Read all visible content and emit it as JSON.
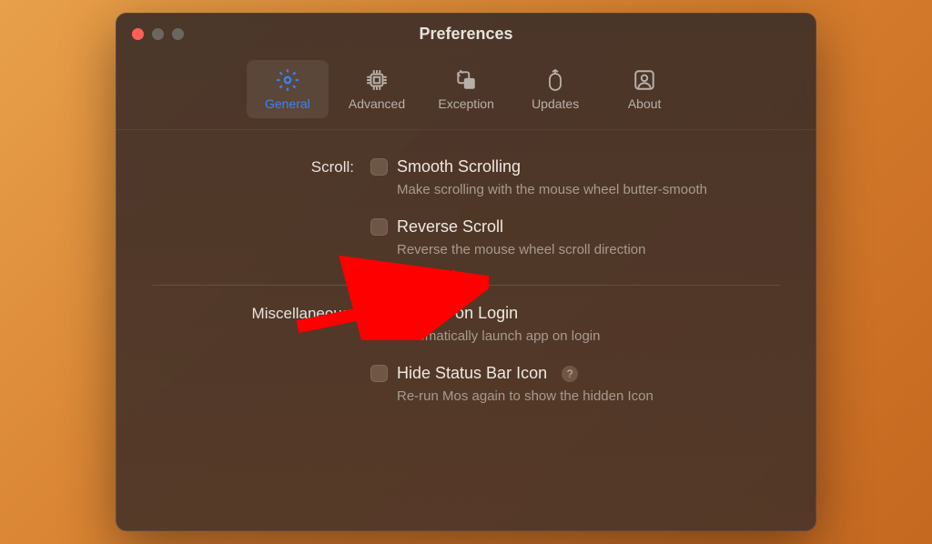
{
  "window": {
    "title": "Preferences"
  },
  "tabs": {
    "general": "General",
    "advanced": "Advanced",
    "exception": "Exception",
    "updates": "Updates",
    "about": "About"
  },
  "sections": {
    "scroll": {
      "label": "Scroll:",
      "smooth": {
        "label": "Smooth Scrolling",
        "description": "Make scrolling with the mouse wheel butter-smooth"
      },
      "reverse": {
        "label": "Reverse Scroll",
        "description": "Reverse the mouse wheel scroll direction"
      }
    },
    "misc": {
      "label": "Miscellaneous:",
      "launch": {
        "label": "Launch on Login",
        "description": "Automatically launch app on login"
      },
      "hide": {
        "label": "Hide Status Bar Icon",
        "description": "Re-run Mos again to show the hidden Icon"
      }
    }
  },
  "help": "?"
}
